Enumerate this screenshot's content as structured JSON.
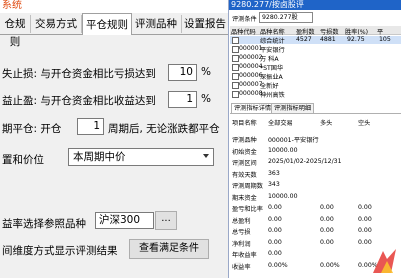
{
  "left": {
    "title": "系统",
    "tabs": [
      "仓规则",
      "交易方式",
      "平仓规则",
      "评测品种",
      "设置报告"
    ],
    "active_tab": 2,
    "row1": {
      "label": "失止损: 与开仓资金相比亏损达到",
      "value": "10",
      "unit": "%"
    },
    "row2": {
      "label": "益止盈: 与开仓资金相比收益达到",
      "value": "1",
      "unit": "%"
    },
    "row3": {
      "label_pre": "期平仓: 开仓",
      "value": "1",
      "label_post": "周期后, 无论涨跌都平仓"
    },
    "row4": {
      "label": "置和价位",
      "select": "本周期中价"
    },
    "row5": {
      "label": "益率选择参照品种",
      "value": "沪深300",
      "more": "..."
    },
    "row6": {
      "label": "间维度方式显示评测结果",
      "button": "查看满足条件"
    }
  },
  "right": {
    "title": "9280.277/按卤股评",
    "code_label": "评测条件",
    "code_value": "9280.277股",
    "headers": [
      "品种代码",
      "品种名称",
      "盈利数",
      "亏损数",
      "胜率(%)",
      "平"
    ],
    "rows": [
      {
        "code": "",
        "name": "综合统计",
        "win": "4527",
        "loss": "4881",
        "rate": "92.75",
        "flat": "105",
        "highlight": true
      },
      {
        "code": "000001",
        "name": "平安银行",
        "win": "",
        "loss": "",
        "rate": "",
        "flat": "",
        "highlight": false
      },
      {
        "code": "000002",
        "name": "万 科A",
        "win": "",
        "loss": "",
        "rate": "",
        "flat": "",
        "highlight": false
      },
      {
        "code": "000004",
        "name": "*ST国华",
        "win": "",
        "loss": "",
        "rate": "",
        "flat": "",
        "highlight": false
      },
      {
        "code": "000006",
        "name": "深振业A",
        "win": "",
        "loss": "",
        "rate": "",
        "flat": "",
        "highlight": false
      },
      {
        "code": "000007",
        "name": "全新好",
        "win": "",
        "loss": "",
        "rate": "",
        "flat": "",
        "highlight": false
      },
      {
        "code": "000008",
        "name": "神州高铁",
        "win": "",
        "loss": "",
        "rate": "",
        "flat": "",
        "highlight": false
      }
    ],
    "subtabs": [
      "评测指标详情",
      "评测指标明细"
    ],
    "detail_headers": [
      "项目名称",
      "全部交易",
      "多头",
      "空头"
    ],
    "details": [
      {
        "k": "评测品种",
        "v": "000001-平安银行",
        "a": "",
        "b": ""
      },
      {
        "k": "初始资金",
        "v": "10000.00",
        "a": "",
        "b": ""
      },
      {
        "k": "评测区间",
        "v": "2025/01/02-2025/12/31",
        "a": "",
        "b": ""
      },
      {
        "k": "有效天数",
        "v": "363",
        "a": "",
        "b": ""
      },
      {
        "k": "评测周期数",
        "v": "343",
        "a": "",
        "b": ""
      },
      {
        "k": "期末资金",
        "v": "10000.00",
        "a": "",
        "b": ""
      },
      {
        "k": "盈亏和比率",
        "v": "0.00",
        "a": "0.00",
        "b": "0.00"
      },
      {
        "k": "总盈利",
        "v": "0.00",
        "a": "0.00",
        "b": "0.00"
      },
      {
        "k": "总亏损",
        "v": "0.00",
        "a": "0.00",
        "b": "0.00"
      },
      {
        "k": "净利润",
        "v": "0.00",
        "a": "0.00",
        "b": "0.00"
      },
      {
        "k": "年收益率",
        "v": "0.00",
        "a": "",
        "b": ""
      },
      {
        "k": "收益率",
        "v": "0.00%",
        "a": "0.00%",
        "b": "0.00%"
      }
    ]
  }
}
